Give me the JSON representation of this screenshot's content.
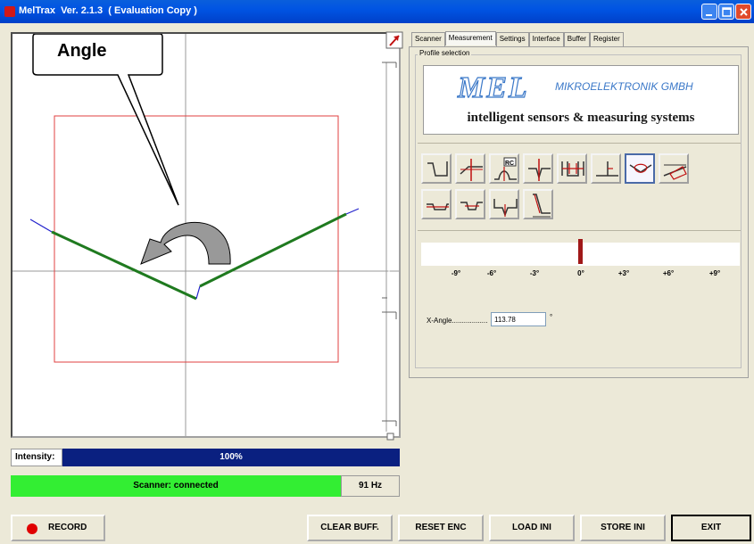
{
  "window": {
    "title": "MelTrax  Ver. 2.1.3  ( Evaluation Copy )"
  },
  "annotation": {
    "callout": "Angle"
  },
  "tabs": [
    "Scanner",
    "Measurement",
    "Settings",
    "Interface",
    "Buffer",
    "Register"
  ],
  "active_tab": "Measurement",
  "profile_selection": {
    "title": "Profile selection",
    "logo": {
      "brand": "MEL",
      "company": "MIKROELEKTRONIK GMBH",
      "tagline": "intelligent sensors & measuring systems"
    },
    "active_profile_index": 6
  },
  "angle_scale": {
    "ticks": [
      "-9°",
      "-6°",
      "-3°",
      "0°",
      "+3°",
      "+6°",
      "+9°"
    ],
    "marker_value_deg": 0
  },
  "x_angle": {
    "label": "X-Angle..................",
    "value": "113.78",
    "unit": "°"
  },
  "intensity": {
    "label": "Intensity:",
    "value": "100%",
    "level": 1.0
  },
  "status": {
    "text": "Scanner: connected",
    "frequency": "91 Hz"
  },
  "buttons": {
    "record": "RECORD",
    "clear_buffer": "CLEAR BUFF.",
    "reset_enc": "RESET ENC",
    "load_ini": "LOAD INI",
    "store_ini": "STORE INI",
    "exit": "EXIT"
  },
  "colors": {
    "profile_line": "#1f7a1f",
    "profile_edge": "#2222cc",
    "roi_box": "#e04040",
    "status_ok": "#33ee33",
    "intensity_bar": "#0a2080"
  }
}
